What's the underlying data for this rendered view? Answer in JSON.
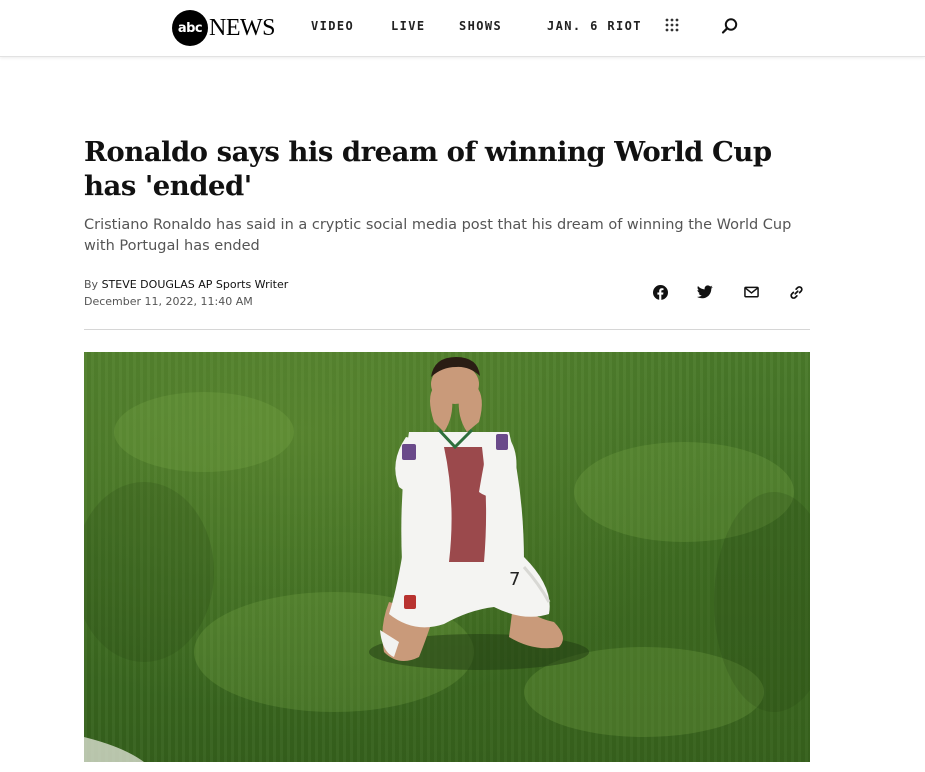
{
  "header": {
    "logo_abc": "abc",
    "logo_news": "NEWS",
    "nav": [
      {
        "label": "VIDEO"
      },
      {
        "label": "LIVE"
      },
      {
        "label": "SHOWS"
      },
      {
        "label": "JAN. 6 RIOT"
      }
    ],
    "grid_icon": "grid-icon",
    "search_icon": "search-icon"
  },
  "article": {
    "headline": "Ronaldo says his dream of winning World Cup has 'ended'",
    "dek": "Cristiano Ronaldo has said in a cryptic social media post that his dream of winning the World Cup with Portugal has ended",
    "byline_prefix": "By",
    "author": "STEVE DOUGLAS AP Sports Writer",
    "date": "December 11, 2022, 11:40 AM",
    "share_icons": [
      "facebook-icon",
      "twitter-icon",
      "email-icon",
      "link-icon"
    ]
  },
  "hero_image": {
    "shirt_number": "7"
  },
  "colors": {
    "pitch_green": "#3f6e24",
    "shirt_white": "#f4f4f2",
    "shirt_red": "#8b2a2f",
    "text_dark": "#111111",
    "text_muted": "#555555"
  }
}
